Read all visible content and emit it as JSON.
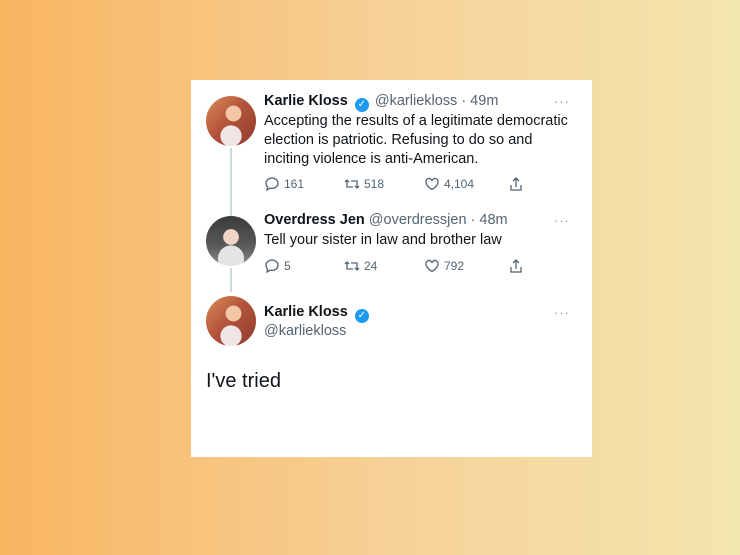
{
  "tweets": [
    {
      "name": "Karlie Kloss",
      "handle": "@karliekloss",
      "time": "· 49m",
      "more": "···",
      "text": "Accepting the results of a legitimate democratic election is patriotic. Refusing to do so and inciting violence is anti-American.",
      "replies": "161",
      "retweets": "518",
      "likes": "4,104"
    },
    {
      "name": "Overdress Jen",
      "handle": "@overdressjen",
      "time": "· 48m",
      "more": "···",
      "text": "Tell your sister in law and brother law",
      "replies": "5",
      "retweets": "24",
      "likes": "792"
    }
  ],
  "reply": {
    "name": "Karlie Kloss",
    "handle": "@karliekloss",
    "more": "···",
    "text": "I've tried"
  },
  "colors": {
    "verified": "#1d9bf0",
    "text": "#0f1419",
    "muted": "#536471",
    "thread_line": "#cfd9de"
  },
  "icons": [
    "verified-badge-icon",
    "reply-icon",
    "retweet-icon",
    "like-icon",
    "share-icon",
    "more-icon"
  ]
}
